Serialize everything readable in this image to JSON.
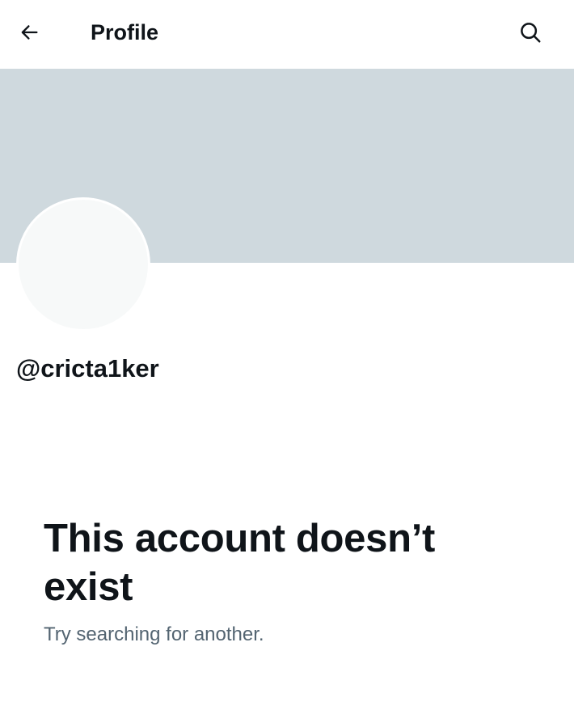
{
  "header": {
    "back_icon": "arrow-left-icon",
    "title": "Profile",
    "search_icon": "search-icon"
  },
  "profile": {
    "banner_color": "#cfd9de",
    "avatar_color": "#f7f9f9",
    "handle": "@cricta1ker"
  },
  "empty_state": {
    "title": "This account doesn’t exist",
    "subtitle": "Try searching for another."
  },
  "colors": {
    "text_primary": "#0f1419",
    "text_secondary": "#536471",
    "background": "#ffffff"
  }
}
